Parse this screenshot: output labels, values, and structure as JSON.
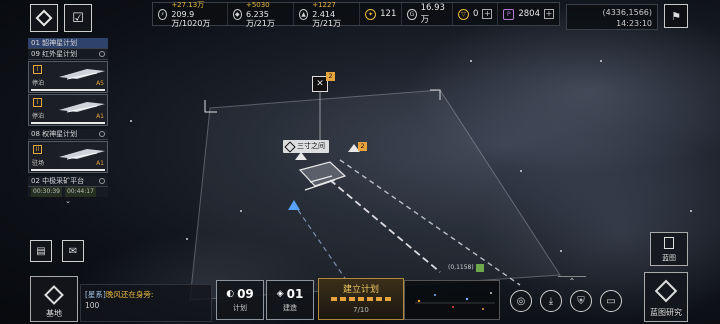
{
  "resources": [
    {
      "icon": "energy-icon",
      "plus": "+27.13万",
      "value": "209.9万/1020万"
    },
    {
      "icon": "crystal-icon",
      "plus": "+5030",
      "value": "6.235万/21万"
    },
    {
      "icon": "metal-icon",
      "plus": "+1227",
      "value": "2.414万/21万"
    }
  ],
  "currencies": [
    {
      "icon": "rank-icon",
      "value": "121"
    },
    {
      "icon": "cycle-icon",
      "value": "16.93万"
    },
    {
      "icon": "coin-icon",
      "value": "0",
      "add": "+"
    },
    {
      "icon": "premium-icon",
      "value": "2804",
      "add": "+"
    }
  ],
  "location": {
    "coords": "(4336,1566)",
    "time": "14:23:10"
  },
  "fleets": {
    "groups": [
      {
        "label": "01 韶神星计划",
        "active": true
      },
      {
        "label": "09 红外星计划",
        "active": false
      },
      {
        "label": "08 权神星计划",
        "active": false
      },
      {
        "label": "02 中极采矿平台",
        "active": false
      }
    ],
    "cards": [
      {
        "status": "停泊",
        "rank": "A5",
        "icon": "I"
      },
      {
        "status": "停泊",
        "rank": "A1",
        "icon": "I"
      },
      {
        "status": "驻场",
        "rank": "A1",
        "icon": "II"
      }
    ],
    "timers": [
      "00:30:39",
      "00:44:17"
    ],
    "expand": "⌄"
  },
  "map": {
    "fleet_name": "三寸之间",
    "fleet_level": "2",
    "target_level": "2",
    "coord_tag": "(0,1158)"
  },
  "chat": {
    "channel": "[星系]",
    "name": "晚风还在身旁:",
    "message": "100"
  },
  "bottom": {
    "base_label": "基地",
    "plan_count": "09",
    "plan_label": "计划",
    "build_count": "01",
    "build_label": "建造",
    "build_plan_title": "建立计划",
    "build_plan_progress": "7/10",
    "blueprint_label": "蓝图",
    "blueprint_research_label": "蓝图研究"
  },
  "colors": {
    "accent": "#e7a43c",
    "highlight": "#f0c864",
    "premium": "#b47ad8",
    "active_tab": "#37508a"
  }
}
